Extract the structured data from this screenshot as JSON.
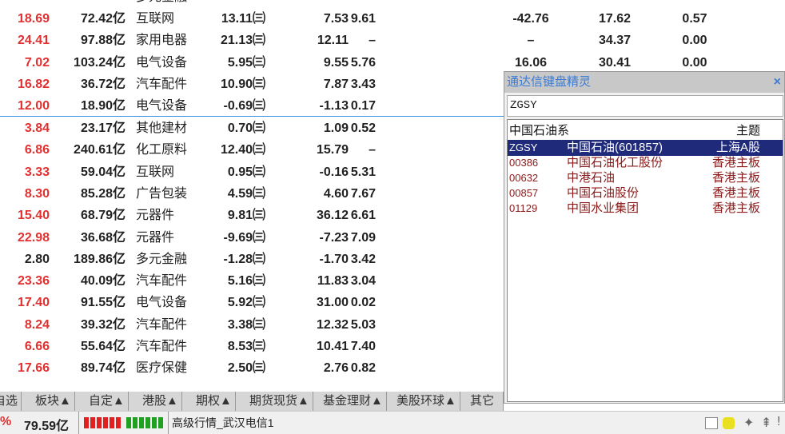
{
  "partial_top_industry": "多元金融",
  "rows": [
    {
      "price": "18.69",
      "cap": "72.42亿",
      "industry": "互联网",
      "pe": "13.11㈢",
      "pe2": "7.53",
      "x5": "9.61",
      "r1": "-42.76",
      "r2": "17.62",
      "r3": "0.57"
    },
    {
      "price": "24.41",
      "cap": "97.88亿",
      "industry": "家用电器",
      "pe": "21.13㈢",
      "pe2": "12.11",
      "x5": "–",
      "r1": "–",
      "r2": "34.37",
      "r3": "0.00"
    },
    {
      "price": "7.02",
      "cap": "103.24亿",
      "industry": "电气设备",
      "pe": "5.95㈢",
      "pe2": "9.55",
      "x5": "5.76",
      "r1": "16.06",
      "r2": "30.41",
      "r3": "0.00"
    },
    {
      "price": "16.82",
      "cap": "36.72亿",
      "industry": "汽车配件",
      "pe": "10.90㈢",
      "pe2": "7.87",
      "x5": "3.43"
    },
    {
      "price": "12.00",
      "cap": "18.90亿",
      "industry": "电气设备",
      "pe": "-0.69㈢",
      "pe2": "-1.13",
      "x5": "0.17"
    },
    {
      "price": "3.84",
      "cap": "23.17亿",
      "industry": "其他建材",
      "pe": "0.70㈢",
      "pe2": "1.09",
      "x5": "0.52"
    },
    {
      "price": "6.86",
      "cap": "240.61亿",
      "industry": "化工原料",
      "pe": "12.40㈢",
      "pe2": "15.79",
      "x5": "–"
    },
    {
      "price": "3.33",
      "cap": "59.04亿",
      "industry": "互联网",
      "pe": "0.95㈢",
      "pe2": "-0.16",
      "x5": "5.31"
    },
    {
      "price": "8.30",
      "cap": "85.28亿",
      "industry": "广告包装",
      "pe": "4.59㈢",
      "pe2": "4.60",
      "x5": "7.67"
    },
    {
      "price": "15.40",
      "cap": "68.79亿",
      "industry": "元器件",
      "pe": "9.81㈢",
      "pe2": "36.12",
      "x5": "6.61"
    },
    {
      "price": "22.98",
      "cap": "36.68亿",
      "industry": "元器件",
      "pe": "-9.69㈢",
      "pe2": "-7.23",
      "x5": "7.09"
    },
    {
      "price": "2.80",
      "cap": "189.86亿",
      "industry": "多元金融",
      "pe": "-1.28㈢",
      "pe2": "-1.70",
      "x5": "3.42",
      "black": true
    },
    {
      "price": "23.36",
      "cap": "40.09亿",
      "industry": "汽车配件",
      "pe": "5.16㈢",
      "pe2": "11.83",
      "x5": "3.04"
    },
    {
      "price": "17.40",
      "cap": "91.55亿",
      "industry": "电气设备",
      "pe": "5.92㈢",
      "pe2": "31.00",
      "x5": "0.02"
    },
    {
      "price": "8.24",
      "cap": "39.32亿",
      "industry": "汽车配件",
      "pe": "3.38㈢",
      "pe2": "12.32",
      "x5": "5.03"
    },
    {
      "price": "6.66",
      "cap": "55.64亿",
      "industry": "汽车配件",
      "pe": "8.53㈢",
      "pe2": "10.41",
      "x5": "7.40"
    },
    {
      "price": "17.66",
      "cap": "89.74亿",
      "industry": "医疗保健",
      "pe": "2.50㈢",
      "pe2": "2.76",
      "x5": "0.82"
    }
  ],
  "tabs": [
    "自选",
    "板块▲",
    "自定▲",
    "港股▲",
    "期权▲",
    "期货现货▲",
    "基金理财▲",
    "美股环球▲",
    "其它品种"
  ],
  "status": {
    "pct": "%",
    "amount": "79.59亿",
    "server": "高级行情_武汉电信1"
  },
  "popup": {
    "title": "通达信键盘精灵",
    "close": "×",
    "input": "ZGSY",
    "header": {
      "name": "中国石油系",
      "market": "主题"
    },
    "items": [
      {
        "code": "ZGSY",
        "name": "中国石油(601857)",
        "market": "上海A股",
        "selected": true
      },
      {
        "code": "00386",
        "name": "中国石油化工股份",
        "market": "香港主板"
      },
      {
        "code": "00632",
        "name": "中港石油",
        "market": "香港主板"
      },
      {
        "code": "00857",
        "name": "中国石油股份",
        "market": "香港主板"
      },
      {
        "code": "01129",
        "name": "中国水业集团",
        "market": "香港主板"
      }
    ]
  }
}
